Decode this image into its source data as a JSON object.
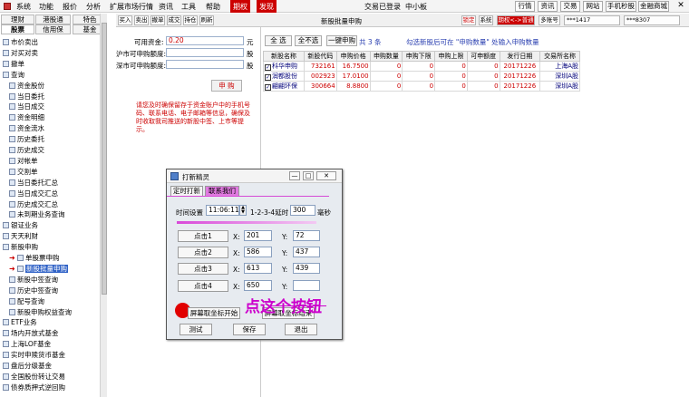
{
  "menubar": {
    "items": [
      "系统",
      "功能",
      "报价",
      "分析",
      "扩展市场行情",
      "资讯",
      "工具",
      "帮助"
    ],
    "highlight1": "期权",
    "highlight2": "发现",
    "status": "交易已登录",
    "board": "中小板",
    "right_buttons": [
      "行情",
      "资讯",
      "交易",
      "网站",
      "手机秒股",
      "金融商城"
    ]
  },
  "toolbar": {
    "buttons": [
      "买入",
      "卖出",
      "撤单",
      "成交",
      "持仓",
      "刷新"
    ],
    "title": "新股批量申购",
    "right_buttons": [
      "锁定",
      "系统",
      "期权<->普通",
      "多账号"
    ],
    "account1": "***1417",
    "account2": "***8307"
  },
  "sidebar": {
    "tabs_row1": [
      "理财",
      "港股通",
      "特色"
    ],
    "tabs_row2": [
      "股票",
      "信用保",
      "基金"
    ],
    "items": [
      {
        "label": "市价卖出",
        "level": 1
      },
      {
        "label": "对买对卖",
        "level": 1
      },
      {
        "label": "撤单",
        "level": 1
      },
      {
        "label": "查询",
        "level": 1
      },
      {
        "label": "资金股份",
        "level": 2
      },
      {
        "label": "当日委托",
        "level": 2
      },
      {
        "label": "当日成交",
        "level": 2
      },
      {
        "label": "资金明细",
        "level": 2
      },
      {
        "label": "资金流水",
        "level": 2
      },
      {
        "label": "历史委托",
        "level": 2
      },
      {
        "label": "历史成交",
        "level": 2
      },
      {
        "label": "对帐单",
        "level": 2
      },
      {
        "label": "交割单",
        "level": 2
      },
      {
        "label": "当日委托汇总",
        "level": 2
      },
      {
        "label": "当日成交汇总",
        "level": 2
      },
      {
        "label": "历史成交汇总",
        "level": 2
      },
      {
        "label": "未到期业务查询",
        "level": 2
      },
      {
        "label": "银证业务",
        "level": 1
      },
      {
        "label": "天天利财",
        "level": 1
      },
      {
        "label": "新股申购",
        "level": 1
      },
      {
        "label": "单股票申购",
        "level": 2,
        "arrow": true
      },
      {
        "label": "新股批量申购",
        "level": 2,
        "arrow": true,
        "selected": true
      },
      {
        "label": "新股中签查询",
        "level": 2
      },
      {
        "label": "历史中签查询",
        "level": 2
      },
      {
        "label": "配号查询",
        "level": 2
      },
      {
        "label": "新股申购权益查询",
        "level": 2
      },
      {
        "label": "ETF业务",
        "level": 1
      },
      {
        "label": "场内开放式基金",
        "level": 1
      },
      {
        "label": "上海LOF基金",
        "level": 1
      },
      {
        "label": "实时申赎货币基金",
        "level": 1
      },
      {
        "label": "盘后分级基金",
        "level": 1
      },
      {
        "label": "全国股份转让交易",
        "level": 1
      },
      {
        "label": "债券质押式逆回购",
        "level": 1
      }
    ]
  },
  "form": {
    "avail_label": "可用资金:",
    "avail_value": "0.20",
    "avail_unit": "元",
    "sh_label": "沪市可申购额度:",
    "sh_unit": "股",
    "sz_label": "深市可申购额度:",
    "sz_unit": "股",
    "buy_button": "申 购",
    "note": "请您及时确保留存于资金账户中的手机号码、联系电话、电子邮箱等信息，确保及时收取我司推送的新股中签、上市等提示。"
  },
  "right": {
    "btn_all": "全 选",
    "btn_none": "全不选",
    "btn_buy": "一键申购",
    "count_text": "共 3 条",
    "hint": "勾选新股后可在 \"申购数量\" 处输入申购数量",
    "headers": [
      "新股名称",
      "新股代码",
      "申购价格",
      "申购数量",
      "申购下限",
      "申购上限",
      "可申额度",
      "发行日期",
      "交易所名称"
    ],
    "rows": [
      [
        "科华申购",
        "732161",
        "16.7500",
        "0",
        "0",
        "0",
        "0",
        "20171226",
        "上海A股"
      ],
      [
        "润都股份",
        "002923",
        "17.0100",
        "0",
        "0",
        "0",
        "0",
        "20171226",
        "深圳A股"
      ],
      [
        "翩翩环保",
        "300664",
        "8.8800",
        "0",
        "0",
        "0",
        "0",
        "20171226",
        "深圳A股"
      ]
    ]
  },
  "dialog": {
    "title": "打新精灵",
    "tab1": "定时打新",
    "tab2": "联系我们",
    "time_label": "时间设置",
    "time_value": "11:06:11",
    "seq_label": "1-2-3-4延时",
    "delay_value": "300",
    "delay_unit": "毫秒",
    "clicks": [
      {
        "label": "点击1",
        "x": "201",
        "y": "72"
      },
      {
        "label": "点击2",
        "x": "586",
        "y": "437"
      },
      {
        "label": "点击3",
        "x": "613",
        "y": "439"
      },
      {
        "label": "点击4",
        "x": "650",
        "y": ""
      }
    ],
    "x_label": "X:",
    "y_label": "Y:",
    "capture_start": "屏幕取坐标开始",
    "capture_end": "屏幕取坐标结束",
    "btn_test": "测试",
    "btn_save": "保存",
    "btn_exit": "退出"
  },
  "annotation": {
    "text": "点这个按钮"
  },
  "colors": {
    "accent_red": "#cc0000",
    "selection_blue": "#3163c7",
    "annotation_magenta": "#cc00cc"
  }
}
